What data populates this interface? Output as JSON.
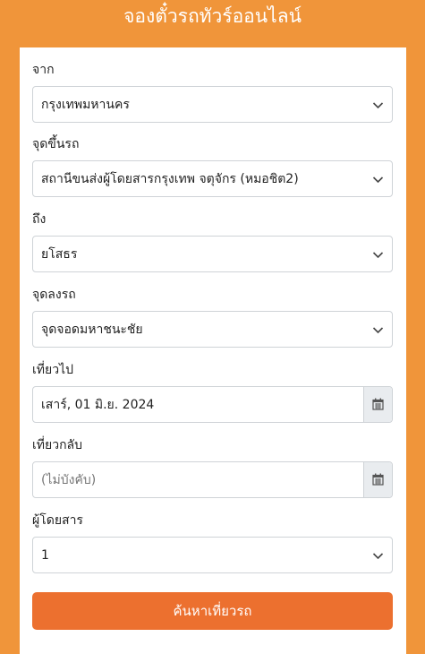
{
  "header": {
    "title": "จองตั๋วรถทัวร์ออนไลน์"
  },
  "form": {
    "from": {
      "label": "จาก",
      "value": "กรุงเทพมหานคร"
    },
    "boarding": {
      "label": "จุดขึ้นรถ",
      "value": "สถานีขนส่งผู้โดยสารกรุงเทพ จตุจักร (หมอชิต2)"
    },
    "to": {
      "label": "ถึง",
      "value": "ยโสธร"
    },
    "dropoff": {
      "label": "จุดลงรถ",
      "value": "จุดจอดมหาชนะชัย"
    },
    "depart": {
      "label": "เที่ยวไป",
      "value": "เสาร์, 01 มิ.ย. 2024"
    },
    "return": {
      "label": "เที่ยวกลับ",
      "placeholder": "(ไม่บังคับ)"
    },
    "passengers": {
      "label": "ผู้โดยสาร",
      "value": "1"
    },
    "search_label": "ค้นหาเที่ยวรถ"
  },
  "icons": {
    "select": "chevron-down-icon",
    "date": "calendar-icon"
  },
  "colors": {
    "background": "#f0953a",
    "button": "#ec702f",
    "addon": "#e9ecef"
  }
}
